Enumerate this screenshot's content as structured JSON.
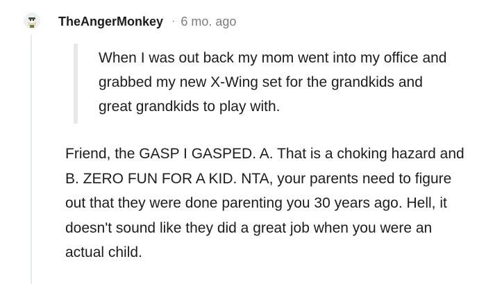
{
  "comment": {
    "avatar_icon": "snoo-avatar-icon",
    "username": "TheAngerMonkey",
    "separator": "·",
    "timestamp": "6 mo. ago",
    "quote": "When I was out back my mom went into my office and grabbed my new X-Wing set for the grandkids and great grandkids to play with.",
    "body": "Friend, the GASP I GASPED. A. That is a choking hazard and B. ZERO FUN FOR A KID. NTA, your parents need to figure out that they were done parenting you 30 years ago. Hell, it doesn't sound like they did a great job when you were an actual child."
  },
  "colors": {
    "text": "#1c1c1c",
    "meta": "#7c7c7c",
    "quote_bar": "#e8e8e8",
    "thread_line": "#e8ebed"
  }
}
